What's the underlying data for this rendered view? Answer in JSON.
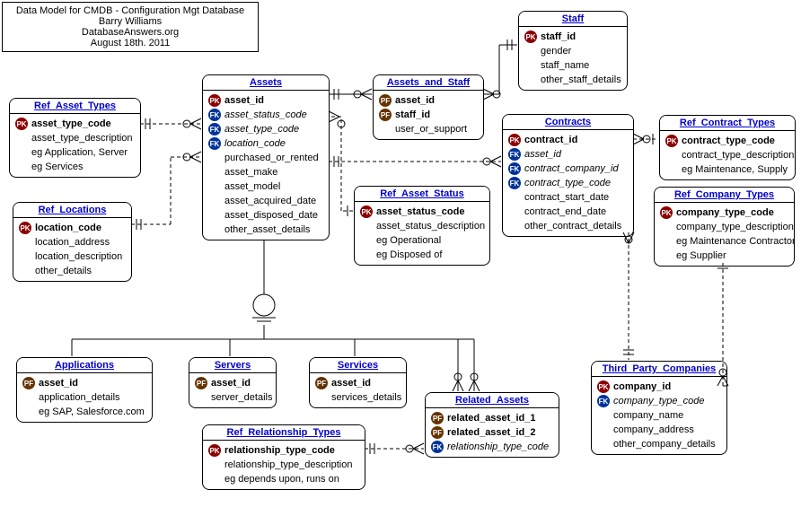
{
  "info": {
    "line1": "Data Model for CMDB - Configuration Mgt Database",
    "line2": "Barry Williams",
    "line3": "DatabaseAnswers.org",
    "line4": "August 18th. 2011"
  },
  "entities": {
    "ref_asset_types": {
      "title": "Ref_Asset_Types",
      "attrs": [
        {
          "k": "PK",
          "t": "asset_type_code",
          "b": 1
        },
        {
          "t": "asset_type_description"
        },
        {
          "t": "eg Application, Server"
        },
        {
          "t": "eg Services"
        }
      ]
    },
    "ref_locations": {
      "title": "Ref_Locations",
      "attrs": [
        {
          "k": "PK",
          "t": "location_code",
          "b": 1
        },
        {
          "t": "location_address"
        },
        {
          "t": "location_description"
        },
        {
          "t": "other_details"
        }
      ]
    },
    "assets": {
      "title": "Assets",
      "attrs": [
        {
          "k": "PK",
          "t": "asset_id",
          "b": 1
        },
        {
          "k": "FK",
          "t": "asset_status_code",
          "i": 1
        },
        {
          "k": "FK",
          "t": "asset_type_code",
          "i": 1
        },
        {
          "k": "FK",
          "t": "location_code",
          "i": 1
        },
        {
          "t": "purchased_or_rented"
        },
        {
          "t": "asset_make"
        },
        {
          "t": "asset_model"
        },
        {
          "t": "asset_acquired_date"
        },
        {
          "t": "asset_disposed_date"
        },
        {
          "t": "other_asset_details"
        }
      ]
    },
    "assets_and_staff": {
      "title": "Assets_and_Staff",
      "attrs": [
        {
          "k": "PF",
          "t": "asset_id",
          "b": 1
        },
        {
          "k": "PF",
          "t": "staff_id",
          "b": 1
        },
        {
          "t": "user_or_support"
        }
      ]
    },
    "staff": {
      "title": "Staff",
      "attrs": [
        {
          "k": "PK",
          "t": "staff_id",
          "b": 1
        },
        {
          "t": "gender"
        },
        {
          "t": "staff_name"
        },
        {
          "t": "other_staff_details"
        }
      ]
    },
    "contracts": {
      "title": "Contracts",
      "attrs": [
        {
          "k": "PK",
          "t": "contract_id",
          "b": 1
        },
        {
          "k": "FK",
          "t": "asset_id",
          "i": 1
        },
        {
          "k": "FK",
          "t": "contract_company_id",
          "i": 1
        },
        {
          "k": "FK",
          "t": "contract_type_code",
          "i": 1
        },
        {
          "t": "contract_start_date"
        },
        {
          "t": "contract_end_date"
        },
        {
          "t": "other_contract_details"
        }
      ]
    },
    "ref_contract_types": {
      "title": "Ref_Contract_Types",
      "attrs": [
        {
          "k": "PK",
          "t": "contract_type_code",
          "b": 1
        },
        {
          "t": "contract_type_description"
        },
        {
          "t": "eg Maintenance, Supply"
        }
      ]
    },
    "ref_company_types": {
      "title": "Ref_Company_Types",
      "attrs": [
        {
          "k": "PK",
          "t": "company_type_code",
          "b": 1
        },
        {
          "t": "company_type_description"
        },
        {
          "t": "eg Maintenance Contractor"
        },
        {
          "t": "eg Supplier"
        }
      ]
    },
    "ref_asset_status": {
      "title": "Ref_Asset_Status",
      "attrs": [
        {
          "k": "PK",
          "t": "asset_status_code",
          "b": 1
        },
        {
          "t": "asset_status_description"
        },
        {
          "t": "eg Operational"
        },
        {
          "t": "eg Disposed of"
        }
      ]
    },
    "applications": {
      "title": "Applications",
      "attrs": [
        {
          "k": "PF",
          "t": "asset_id",
          "b": 1
        },
        {
          "t": "application_details"
        },
        {
          "t": "eg SAP, Salesforce.com"
        }
      ]
    },
    "servers": {
      "title": "Servers",
      "attrs": [
        {
          "k": "PF",
          "t": "asset_id",
          "b": 1
        },
        {
          "t": "server_details"
        }
      ]
    },
    "services": {
      "title": "Services",
      "attrs": [
        {
          "k": "PF",
          "t": "asset_id",
          "b": 1
        },
        {
          "t": "services_details"
        }
      ]
    },
    "related_assets": {
      "title": "Related_Assets",
      "attrs": [
        {
          "k": "PF",
          "t": "related_asset_id_1",
          "b": 1
        },
        {
          "k": "PF",
          "t": "related_asset_id_2",
          "b": 1
        },
        {
          "k": "FK",
          "t": "relationship_type_code",
          "i": 1
        }
      ]
    },
    "ref_relationship_types": {
      "title": "Ref_Relationship_Types",
      "attrs": [
        {
          "k": "PK",
          "t": "relationship_type_code",
          "b": 1
        },
        {
          "t": "relationship_type_description"
        },
        {
          "t": "eg depends upon, runs on"
        }
      ]
    },
    "third_party_companies": {
      "title": "Third_Party_Companies",
      "attrs": [
        {
          "k": "PK",
          "t": "company_id",
          "b": 1
        },
        {
          "k": "FK",
          "t": "company_type_code",
          "i": 1
        },
        {
          "t": "company_name"
        },
        {
          "t": "company_address"
        },
        {
          "t": "other_company_details"
        }
      ]
    }
  }
}
